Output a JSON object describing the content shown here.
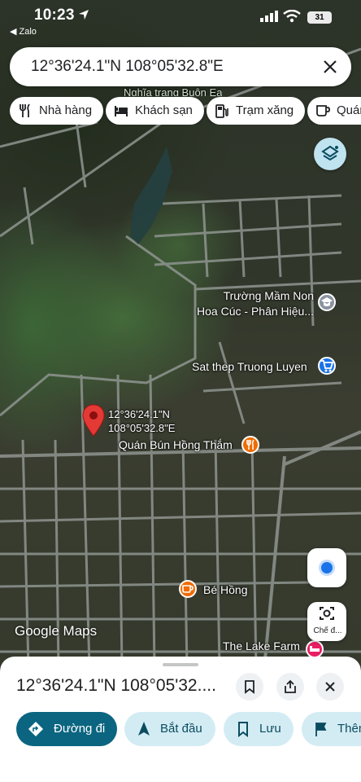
{
  "status_bar": {
    "time": "10:23",
    "back_app": "◀ Zalo",
    "battery": "31"
  },
  "search": {
    "value": "12°36'24.1\"N 108°05'32.8\"E"
  },
  "chips": [
    {
      "label": "Nhà hàng",
      "icon": "utensils-icon"
    },
    {
      "label": "Khách sạn",
      "icon": "bed-icon"
    },
    {
      "label": "Trạm xăng",
      "icon": "gas-station-icon"
    },
    {
      "label": "Quán",
      "icon": "coffee-icon"
    }
  ],
  "map_labels": {
    "top_partial": "Nghĩa trang Buôn Ea",
    "school": "Trường Mầm Non\nHoa Cúc - Phân Hiệu...",
    "shop": "Sat thep Truong Luyen",
    "restaurant": "Quán Bún Hồng Thắm",
    "cafe": "Bé Hồng",
    "farm": "The Lake Farm"
  },
  "pin": {
    "label_line1": "12°36'24.1\"N",
    "label_line2": "108°05'32.8\"E"
  },
  "brand": "Google Maps",
  "lens_label": "Chế đ...",
  "sheet": {
    "title": "12°36'24.1\"N 108°05'32....",
    "actions": [
      {
        "label": "Đường đi",
        "icon": "directions-icon"
      },
      {
        "label": "Bắt đầu",
        "icon": "navigation-arrow-icon"
      },
      {
        "label": "Lưu",
        "icon": "bookmark-icon"
      },
      {
        "label": "Thêm",
        "icon": "flag-icon"
      }
    ]
  },
  "colors": {
    "primary": "#0b6580",
    "secondary": "#d3ecf4",
    "pin": "#e53935",
    "poi_orange": "#ef6c00",
    "poi_blue": "#1a73e8",
    "poi_gray": "#8a94a0",
    "poi_pink": "#e91e63"
  }
}
